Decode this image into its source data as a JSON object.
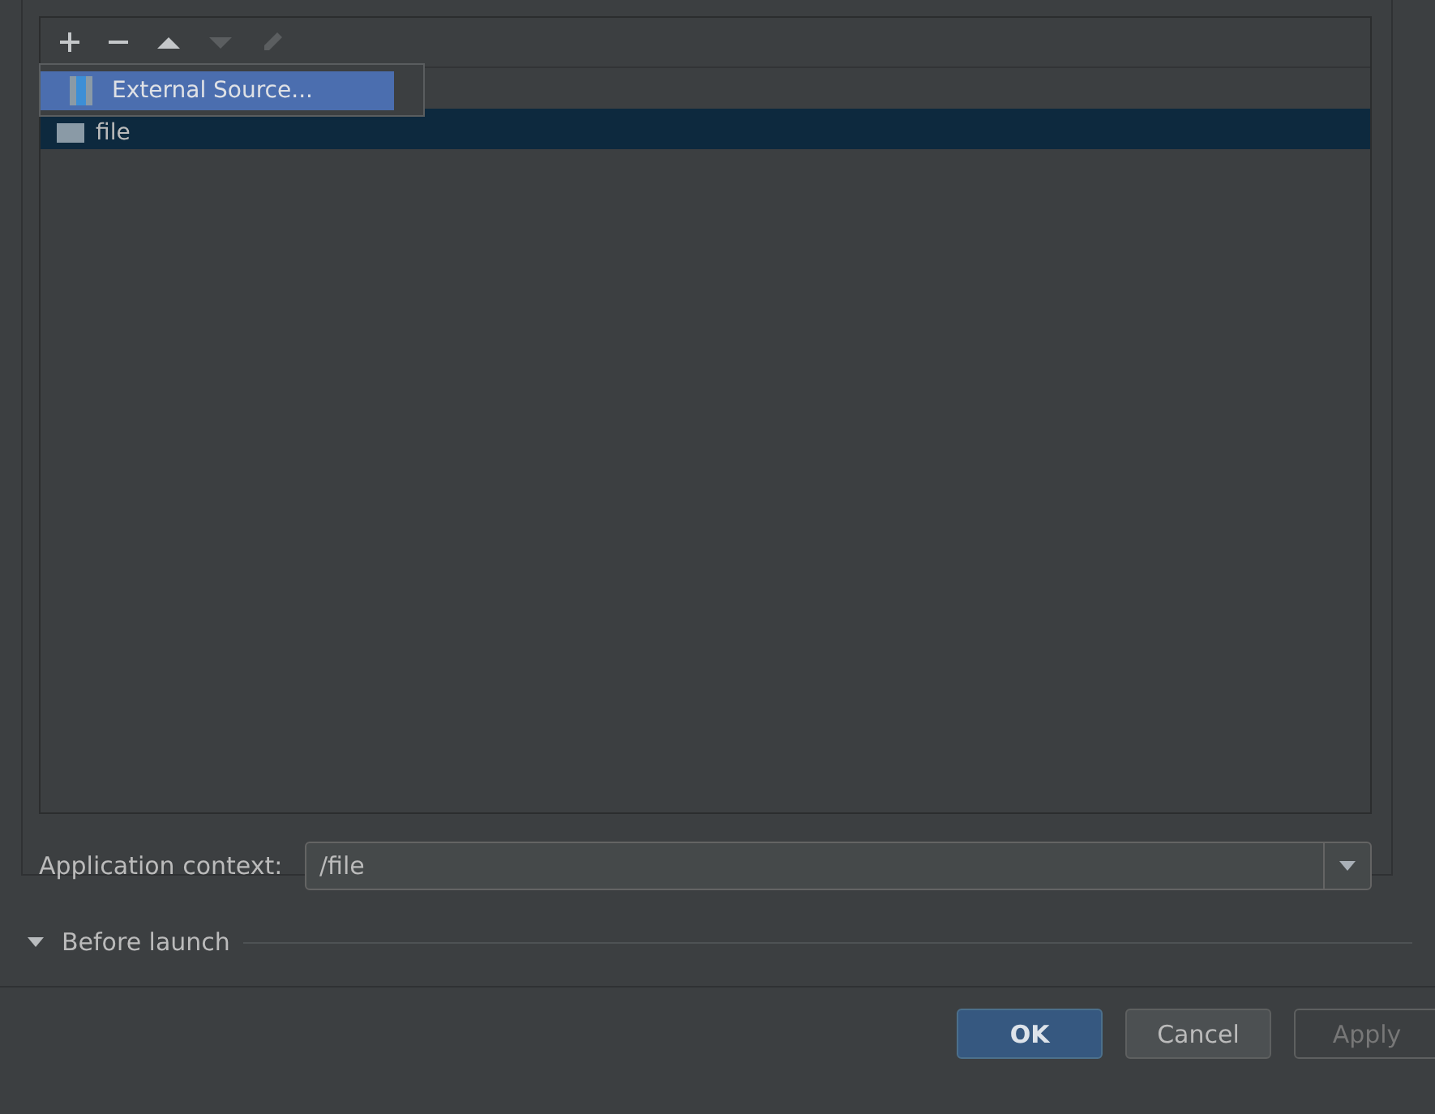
{
  "toolbar": [
    {
      "kind": "add",
      "disabled": false
    },
    {
      "kind": "remove",
      "disabled": false
    },
    {
      "kind": "up",
      "disabled": false
    },
    {
      "kind": "down",
      "disabled": true
    },
    {
      "kind": "edit",
      "disabled": true
    }
  ],
  "popup_menu": {
    "items": [
      {
        "label": "External Source...",
        "selected": true
      }
    ]
  },
  "list": {
    "rows": [
      {
        "label": "file",
        "selected": true
      }
    ]
  },
  "application_context": {
    "label": "Application context:",
    "value": "/file"
  },
  "before_launch": {
    "label": "Before launch",
    "expanded": true
  },
  "buttons": [
    {
      "label": "OK",
      "kind": "primary",
      "disabled": false
    },
    {
      "label": "Cancel",
      "kind": "normal",
      "disabled": false
    },
    {
      "label": "Apply",
      "kind": "normal",
      "disabled": true
    }
  ]
}
